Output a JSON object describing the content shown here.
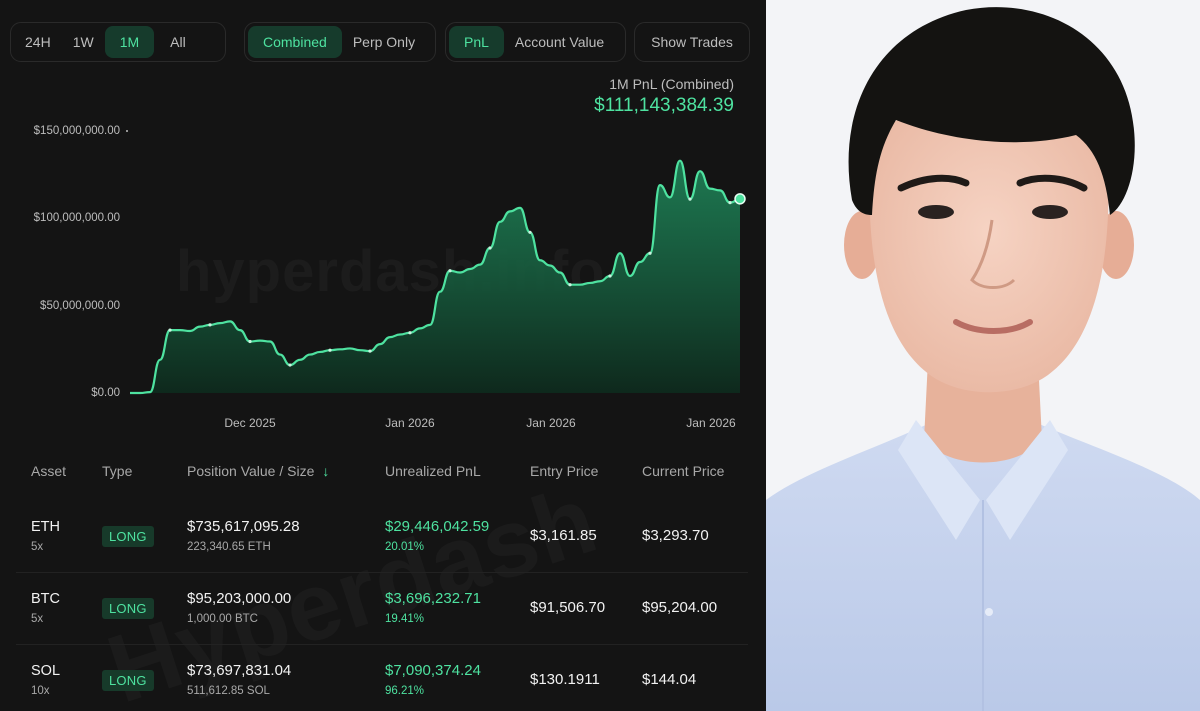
{
  "filters": {
    "range_tabs": [
      {
        "label": "24H",
        "active": false
      },
      {
        "label": "1W",
        "active": false
      },
      {
        "label": "1M",
        "active": true
      },
      {
        "label": "All",
        "active": false
      }
    ],
    "scope_tabs": [
      {
        "label": "Combined",
        "active": true
      },
      {
        "label": "Perp Only",
        "active": false
      }
    ],
    "metric_tabs": [
      {
        "label": "PnL",
        "active": true
      },
      {
        "label": "Account Value",
        "active": false
      }
    ],
    "show_trades_label": "Show Trades"
  },
  "summary": {
    "caption": "1M PnL (Combined)",
    "value": "$111,143,384.39"
  },
  "watermark": "hyperdash.info",
  "watermark2": "Hyperdash",
  "chart_data": {
    "type": "area",
    "y_tick_labels": [
      "$150,000,000.00",
      "$100,000,000.00",
      "$50,000,000.00",
      "$0.00"
    ],
    "y_ticks": [
      150000000,
      100000000,
      50000000,
      0
    ],
    "x_tick_labels": [
      "Dec 2025",
      "Jan 2026",
      "Jan 2026",
      "Jan 2026"
    ],
    "ylim": [
      0,
      150000000
    ],
    "series": [
      {
        "color": "#4ee2a0",
        "values": [
          0,
          0,
          500000,
          19000000,
          36000000,
          36000000,
          35500000,
          38000000,
          39000000,
          40000000,
          41000000,
          36000000,
          29500000,
          30000000,
          29500000,
          22000000,
          16000000,
          19000000,
          22000000,
          23500000,
          24500000,
          25000000,
          25500000,
          24500000,
          24000000,
          28000000,
          32000000,
          33500000,
          34500000,
          37000000,
          39000000,
          58000000,
          70000000,
          69000000,
          71000000,
          73500000,
          83000000,
          98000000,
          104000000,
          106000000,
          92000000,
          76000000,
          73000000,
          69000000,
          62000000,
          62000000,
          63000000,
          64000000,
          67000000,
          80000000,
          67000000,
          75000000,
          80000000,
          119000000,
          112000000,
          133000000,
          111000000,
          127000000,
          117000000,
          116000000,
          109000000,
          111000000
        ]
      }
    ],
    "end_marker_value": 111143384.39
  },
  "table": {
    "columns": [
      "Asset",
      "Type",
      "Position Value / Size",
      "Unrealized PnL",
      "Entry Price",
      "Current Price"
    ],
    "sort_icon": "arrow-down-icon",
    "rows": [
      {
        "asset": "ETH",
        "leverage": "5x",
        "type": "LONG",
        "value": "$735,617,095.28",
        "size": "223,340.65 ETH",
        "pnl": "$29,446,042.59",
        "pnl_pct": "20.01%",
        "entry": "$3,161.85",
        "current": "$3,293.70"
      },
      {
        "asset": "BTC",
        "leverage": "5x",
        "type": "LONG",
        "value": "$95,203,000.00",
        "size": "1,000.00 BTC",
        "pnl": "$3,696,232.71",
        "pnl_pct": "19.41%",
        "entry": "$91,506.70",
        "current": "$95,204.00"
      },
      {
        "asset": "SOL",
        "leverage": "10x",
        "type": "LONG",
        "value": "$73,697,831.04",
        "size": "511,612.85 SOL",
        "pnl": "$7,090,374.24",
        "pnl_pct": "96.21%",
        "entry": "$130.1911",
        "current": "$144.04"
      }
    ]
  },
  "colors": {
    "accent": "#4ee2a0",
    "panel_bg": "#141414",
    "shirt": "#c6d3ee"
  }
}
